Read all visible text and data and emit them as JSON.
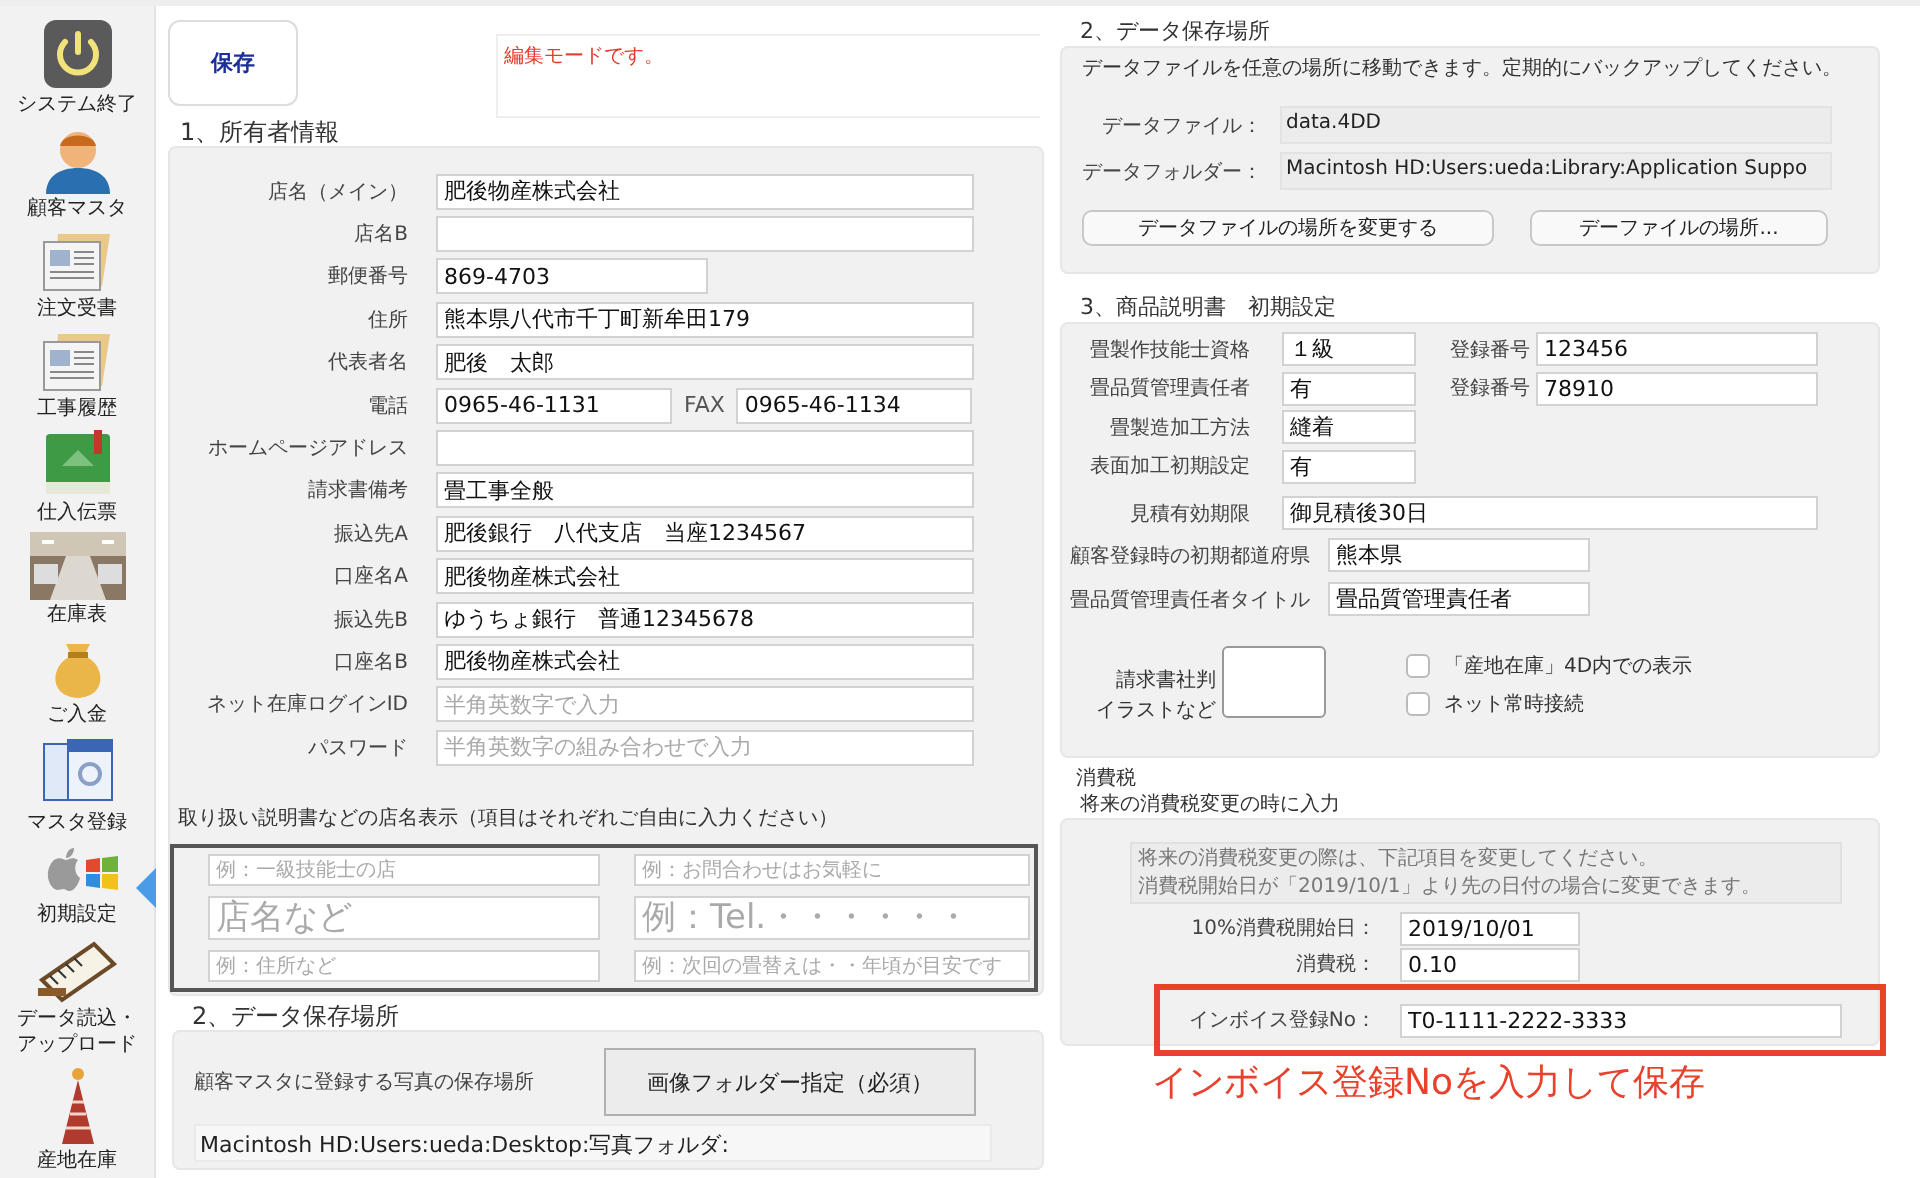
{
  "sidebar": {
    "items": [
      {
        "lines": [
          "システム終了"
        ],
        "selected": false
      },
      {
        "lines": [
          "顧客マスタ"
        ],
        "selected": false
      },
      {
        "lines": [
          "注文受書"
        ],
        "selected": false
      },
      {
        "lines": [
          "工事履歴"
        ],
        "selected": false
      },
      {
        "lines": [
          "仕入伝票"
        ],
        "selected": false
      },
      {
        "lines": [
          "在庫表"
        ],
        "selected": false
      },
      {
        "lines": [
          "ご入金"
        ],
        "selected": false
      },
      {
        "lines": [
          "マスタ登録"
        ],
        "selected": false
      },
      {
        "lines": [
          "初期設定"
        ],
        "selected": true
      },
      {
        "lines": [
          "データ読込・",
          "アップロード"
        ],
        "selected": false
      },
      {
        "lines": [
          "産地在庫"
        ],
        "selected": false
      }
    ]
  },
  "toolbar": {
    "save_button": "保存",
    "status_message": "編集モードです。"
  },
  "owner_section": {
    "title": "1、所有者情報",
    "fields": [
      {
        "kind": "wide",
        "label": "店名（メイン）",
        "value": "肥後物産株式会社"
      },
      {
        "kind": "wide",
        "label": "店名B"
      },
      {
        "kind": "short",
        "label": "郵便番号",
        "value": "869-4703"
      },
      {
        "kind": "wide",
        "label": "住所",
        "value": "熊本県八代市千丁町新牟田179"
      },
      {
        "kind": "wide",
        "label": "代表者名",
        "value": "肥後　太郎"
      },
      {
        "kind": "pair",
        "label": "電話",
        "value": "0965-46-1131",
        "extra_label": "FAX",
        "extra_value": "0965-46-1134"
      },
      {
        "kind": "wide",
        "label": "ホームページアドレス"
      },
      {
        "kind": "wide",
        "label": "請求書備考",
        "value": "畳工事全般"
      },
      {
        "kind": "wide",
        "label": "振込先A",
        "value": "肥後銀行　八代支店　当座1234567"
      },
      {
        "kind": "wide",
        "label": "口座名A",
        "value": "肥後物産株式会社"
      },
      {
        "kind": "wide",
        "label": "振込先B",
        "value": "ゆうちょ銀行　普通12345678"
      },
      {
        "kind": "wide",
        "label": "口座名B",
        "value": "肥後物産株式会社"
      },
      {
        "kind": "wide",
        "label": "ネット在庫ログインID",
        "placeholder": "半角英数字で入力"
      },
      {
        "kind": "wide",
        "label": "パスワード",
        "placeholder": "半角英数字の組み合わせで入力"
      }
    ],
    "display_caption": "取り扱い説明書などの店名表示（項目はそれぞれご自由に入力ください）",
    "display_fields": [
      {
        "kind": "small",
        "placeholder": "例：一級技能士の店"
      },
      {
        "kind": "small",
        "placeholder": "例：お問合わせはお気軽に"
      },
      {
        "kind": "large",
        "placeholder": "店名など"
      },
      {
        "kind": "large",
        "placeholder": "例：Tel.・・・・・・"
      },
      {
        "kind": "small",
        "placeholder": "例：住所など"
      },
      {
        "kind": "small",
        "placeholder": "例：次回の畳替えは・・年頃が目安です"
      }
    ]
  },
  "photo_storage": {
    "title": "2、データ保存場所",
    "label": "顧客マスタに登録する写真の保存場所",
    "button": "画像フォルダー指定（必須）",
    "path": "Macintosh HD:Users:ueda:Desktop:写真フォルダ:"
  },
  "data_storage": {
    "title": "2、データ保存場所",
    "description": "データファイルを任意の場所に移動できます。定期的にバックアップしてください。",
    "rows": [
      {
        "label": "データファイル：",
        "value": "data.4DD"
      },
      {
        "label": "データフォルダー：",
        "value": "Macintosh HD:Users:ueda:Library:Application Suppo"
      }
    ],
    "buttons": [
      "データファイルの場所を変更する",
      "デーファイルの場所..."
    ]
  },
  "manual_settings": {
    "title": "3、商品説明書　初期設定",
    "rows": [
      {
        "kind": "short",
        "label": "畳製作技能士資格",
        "value": "１級",
        "extra_label": "登録番号",
        "extra_value": "123456"
      },
      {
        "kind": "short",
        "label": "畳品質管理責任者",
        "value": "有",
        "extra_label": "登録番号",
        "extra_value": "78910"
      },
      {
        "kind": "short",
        "label": "畳製造加工方法",
        "value": "縫着"
      },
      {
        "kind": "short",
        "label": "表面加工初期設定",
        "value": "有"
      },
      {
        "kind": "wide",
        "label": "見積有効期限",
        "value": "御見積後30日"
      },
      {
        "kind": "long",
        "label": "顧客登録時の初期都道府県",
        "value": "熊本県"
      },
      {
        "kind": "long",
        "label": "畳品質管理責任者タイトル",
        "value": "畳品質管理責任者"
      }
    ],
    "seal_label": [
      "請求書社判",
      "イラストなど"
    ],
    "checkboxes": [
      {
        "label": "「産地在庫」4D内での表示",
        "checked": false
      },
      {
        "label": "ネット常時接続",
        "checked": false
      }
    ]
  },
  "tax": {
    "title": "消費税",
    "subtitle": "将来の消費税変更の時に入力",
    "notice": [
      "将来の消費税変更の際は、下記項目を変更してください。",
      "消費税開始日が「2019/10/1」より先の日付の場合に変更できます。"
    ],
    "rows": [
      {
        "label": "10%消費税開始日：",
        "value": "2019/10/01"
      },
      {
        "label": "消費税：",
        "value": "0.10"
      }
    ],
    "invoice": {
      "label": "インボイス登録No：",
      "value": "T0-1111-2222-3333"
    },
    "annotation": "インボイス登録Noを入力して保存"
  }
}
